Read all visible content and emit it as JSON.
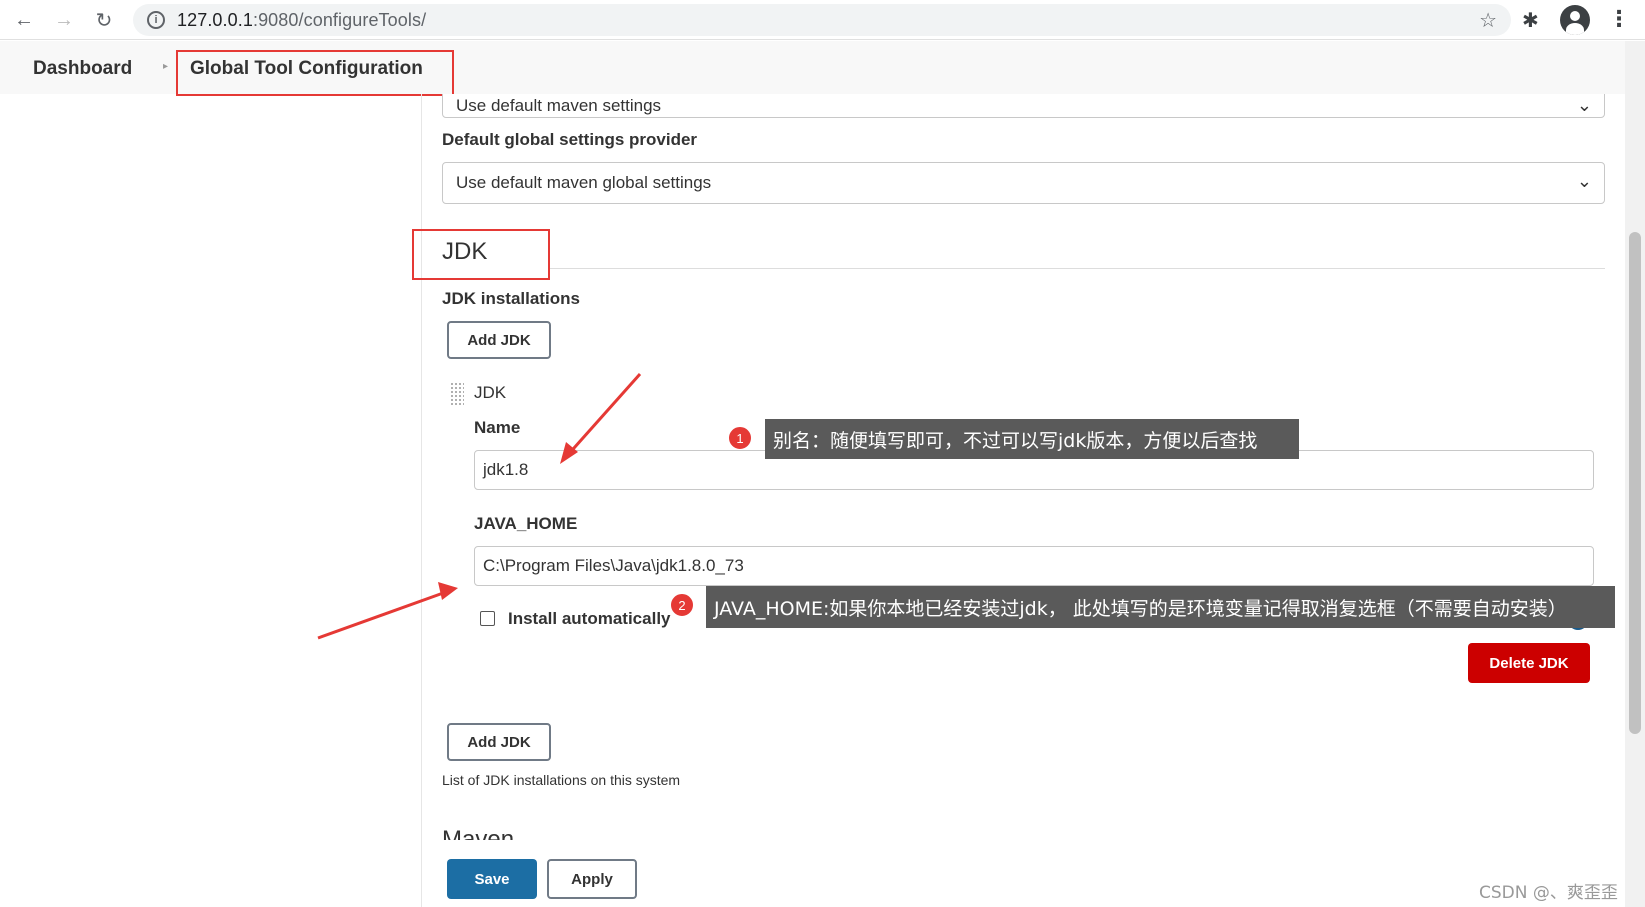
{
  "browser": {
    "url_host": "127.0.0.1",
    "url_rest": ":9080/configureTools/",
    "back_icon": "←",
    "forward_icon": "→",
    "reload_icon": "↻",
    "info_icon": "i",
    "star_icon": "☆",
    "extensions_icon": "✱",
    "menu_icon": "⋮"
  },
  "breadcrumb": {
    "home": "Dashboard",
    "separator": "▸",
    "current": "Global Tool Configuration"
  },
  "maven_settings": {
    "settings_value": "Use default maven settings",
    "global_settings_label": "Default global settings provider",
    "global_settings_value": "Use default maven global settings",
    "chevron": "⌄"
  },
  "jdk": {
    "section_title": "JDK",
    "installations_label": "JDK installations",
    "add_button": "Add JDK",
    "installation": {
      "title": "JDK",
      "name_label": "Name",
      "name_value": "jdk1.8",
      "java_home_label": "JAVA_HOME",
      "java_home_value": "C:\\Program Files\\Java\\jdk1.8.0_73",
      "install_auto_label": "Install automatically",
      "install_auto_checked": false,
      "help": "?",
      "delete_button": "Delete JDK"
    },
    "add_button_bottom": "Add JDK",
    "description": "List of JDK installations on this system"
  },
  "maven_heading": "Maven",
  "actions": {
    "save": "Save",
    "apply": "Apply"
  },
  "annotations": [
    {
      "number": "1",
      "text": "别名：随便填写即可，不过可以写jdk版本，方便以后查找"
    },
    {
      "number": "2",
      "text": "JAVA_HOME:如果你本地已经安装过jdk， 此处填写的是环境变量记得取消复选框（不需要自动安装）"
    }
  ],
  "watermark": "CSDN @、爽歪歪",
  "colors": {
    "annotation_red": "#e53935",
    "danger": "#cc0000",
    "primary": "#1c6ea4",
    "tooltip_bg": "#5a5a5a"
  }
}
